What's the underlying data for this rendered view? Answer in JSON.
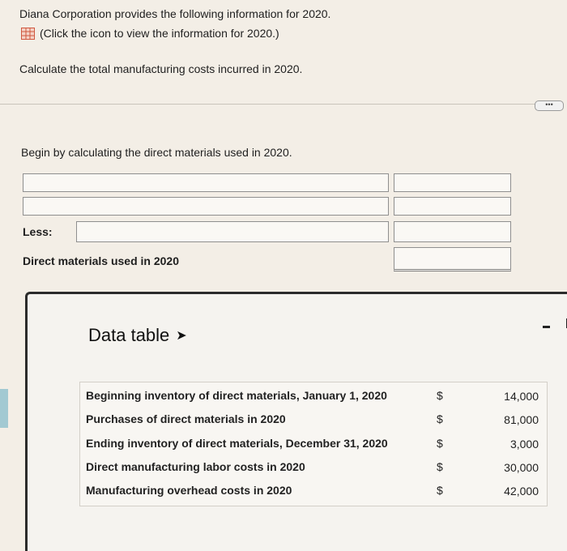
{
  "header": {
    "intro": "Diana Corporation provides the following information for 2020.",
    "icon_link": "(Click the icon to view the information for 2020.)",
    "question": "Calculate the total manufacturing costs incurred in 2020.",
    "more_button": "•••"
  },
  "worksheet": {
    "instruction": "Begin by calculating the direct materials used in 2020.",
    "less_label": "Less:",
    "result_label": "Direct materials used in 2020"
  },
  "data_table": {
    "title": "Data table",
    "rows": [
      {
        "label": "Beginning inventory of direct materials, January 1, 2020",
        "currency": "$",
        "value": "14,000"
      },
      {
        "label": "Purchases of direct materials in 2020",
        "currency": "$",
        "value": "81,000"
      },
      {
        "label": "Ending inventory of direct materials, December 31, 2020",
        "currency": "$",
        "value": "3,000"
      },
      {
        "label": "Direct manufacturing labor costs in 2020",
        "currency": "$",
        "value": "30,000"
      },
      {
        "label": "Manufacturing overhead costs in 2020",
        "currency": "$",
        "value": "42,000"
      }
    ]
  },
  "icons": {
    "table_icon": "table-grid-icon",
    "cursor": "mouse-pointer-icon",
    "minimize": "minimize-icon"
  },
  "colors": {
    "table_icon": "#d0583f",
    "background": "#f3eee6"
  }
}
